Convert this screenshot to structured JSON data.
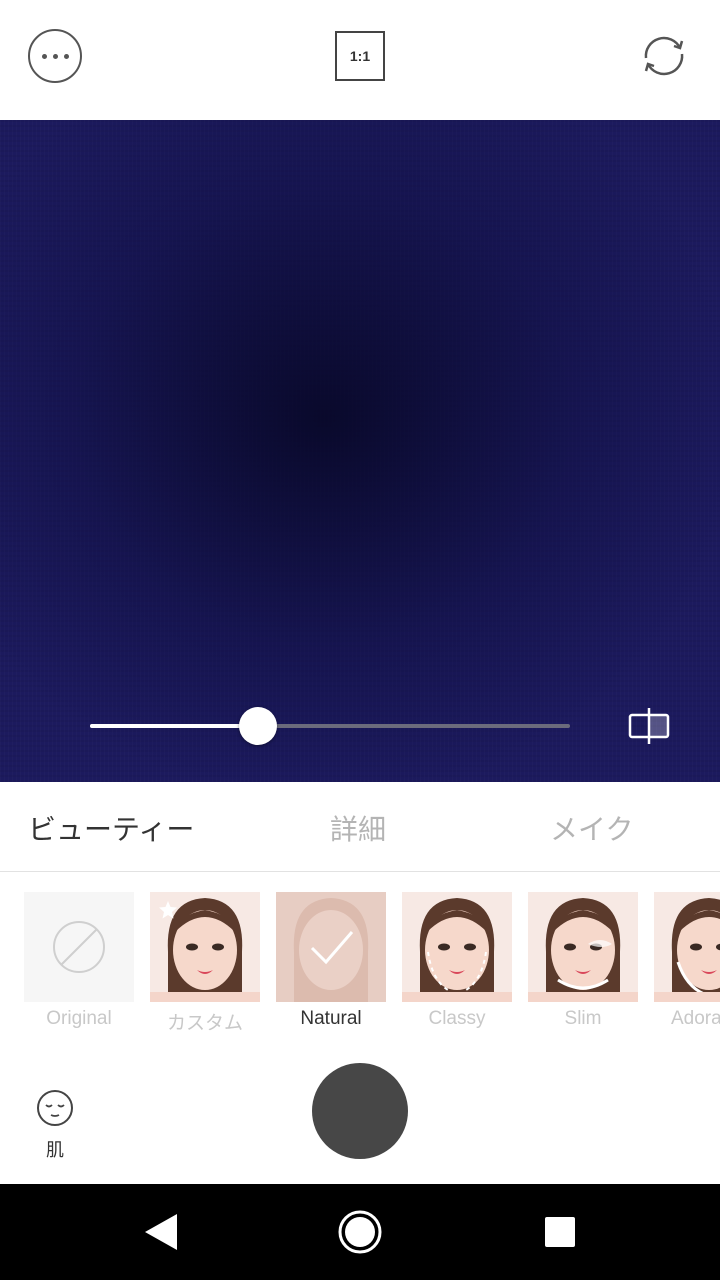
{
  "topbar": {
    "ratio_label": "1:1",
    "more_icon": "more-horizontal-icon",
    "flip_icon": "camera-switch-icon"
  },
  "preview": {
    "background_color": "#1c1a5e",
    "slider_value": 0.35,
    "compare_icon": "compare-split-icon"
  },
  "tabs": [
    {
      "label": "ビューティー",
      "active": true
    },
    {
      "label": "詳細",
      "active": false
    },
    {
      "label": "メイク",
      "active": false
    }
  ],
  "presets": [
    {
      "label": "Original",
      "selected": false
    },
    {
      "label": "カスタム",
      "selected": false
    },
    {
      "label": "Natural",
      "selected": true
    },
    {
      "label": "Classy",
      "selected": false
    },
    {
      "label": "Slim",
      "selected": false
    },
    {
      "label": "Adorable",
      "selected": false
    }
  ],
  "bottom": {
    "skin_label": "肌",
    "skin_icon": "face-icon"
  },
  "navbar": {
    "back_icon": "back-triangle-icon",
    "home_icon": "home-circle-icon",
    "recent_icon": "recent-square-icon"
  }
}
